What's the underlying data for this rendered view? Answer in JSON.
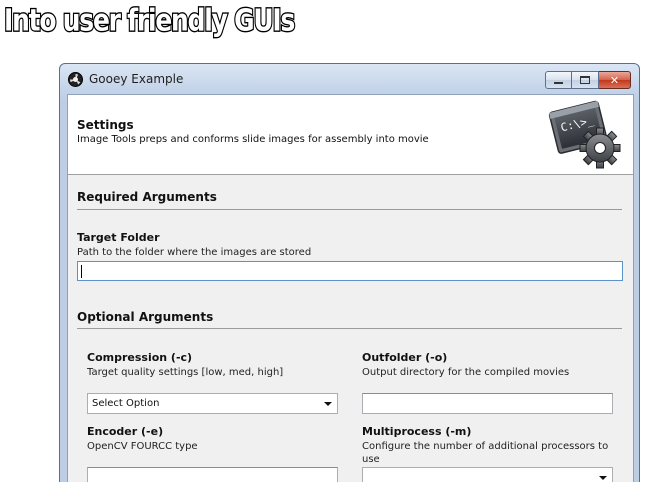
{
  "banner": {
    "text": "Into user friendly GUIs"
  },
  "window": {
    "title": "Gooey Example",
    "buttons": {
      "minimize": "minimize",
      "maximize": "maximize",
      "close": "close"
    }
  },
  "header": {
    "title": "Settings",
    "description": "Image Tools preps and conforms slide images for assembly into movie",
    "icon_text": "C:\\>_",
    "icon": "console-gear-icon"
  },
  "required": {
    "title": "Required Arguments",
    "fields": [
      {
        "label": "Target Folder",
        "help": "Path to the folder where the images are stored",
        "value": ""
      }
    ]
  },
  "optional": {
    "title": "Optional Arguments",
    "fields": [
      {
        "label": "Compression (-c)",
        "help": "Target quality settings [low, med, high]",
        "type": "select",
        "value": "Select Option"
      },
      {
        "label": "Outfolder (-o)",
        "help": "Output directory for the compiled movies",
        "type": "text",
        "value": ""
      },
      {
        "label": "Encoder (-e)",
        "help": "OpenCV FOURCC type",
        "type": "text",
        "value": ""
      },
      {
        "label": "Multiprocess (-m)",
        "help": "Configure the number of additional processors to use",
        "type": "select",
        "value": ""
      }
    ]
  }
}
